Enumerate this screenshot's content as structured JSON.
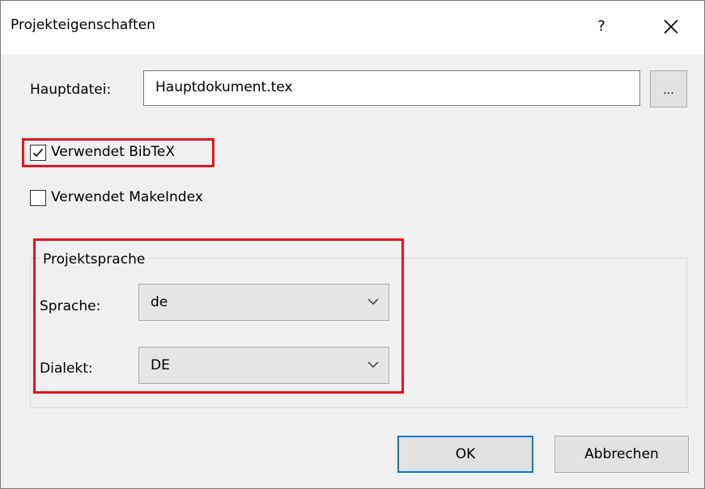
{
  "window": {
    "title": "Projekteigenschaften",
    "help_label": "?",
    "close_icon": "close-icon"
  },
  "main_file": {
    "label": "Hauptdatei:",
    "value": "Hauptdokument.tex",
    "browse_label": "..."
  },
  "options": {
    "bibtex": {
      "label": "Verwendet BibTeX",
      "checked": true
    },
    "makeindex": {
      "label": "Verwendet MakeIndex",
      "checked": false
    }
  },
  "language_group": {
    "title": "Projektsprache",
    "language_label": "Sprache:",
    "language_value": "de",
    "dialect_label": "Dialekt:",
    "dialect_value": "DE"
  },
  "buttons": {
    "ok": "OK",
    "cancel": "Abbrechen"
  },
  "colors": {
    "highlight": "#e8141f",
    "default_button_border": "#0078d7"
  }
}
